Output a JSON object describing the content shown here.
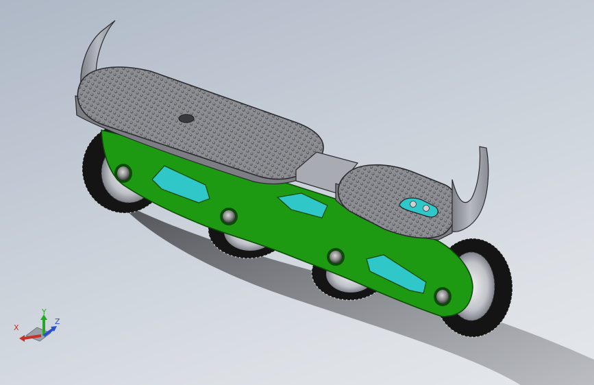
{
  "viewport": {
    "background_top": "#aeb8c6",
    "background_bottom": "#e4e7eb"
  },
  "model": {
    "frame_color": "#1e9a12",
    "frame_edge": "#0d4a08",
    "slot_color": "#2fc7c7",
    "deck_color": "#8f8f95",
    "rim_color": "#c0c3c9",
    "tire_color": "#151515"
  },
  "triad": {
    "x_label": "X",
    "y_label": "Y",
    "z_label": "Z",
    "x_color": "#c8302a",
    "y_color": "#2aa52a",
    "z_color": "#2a4fd0"
  }
}
